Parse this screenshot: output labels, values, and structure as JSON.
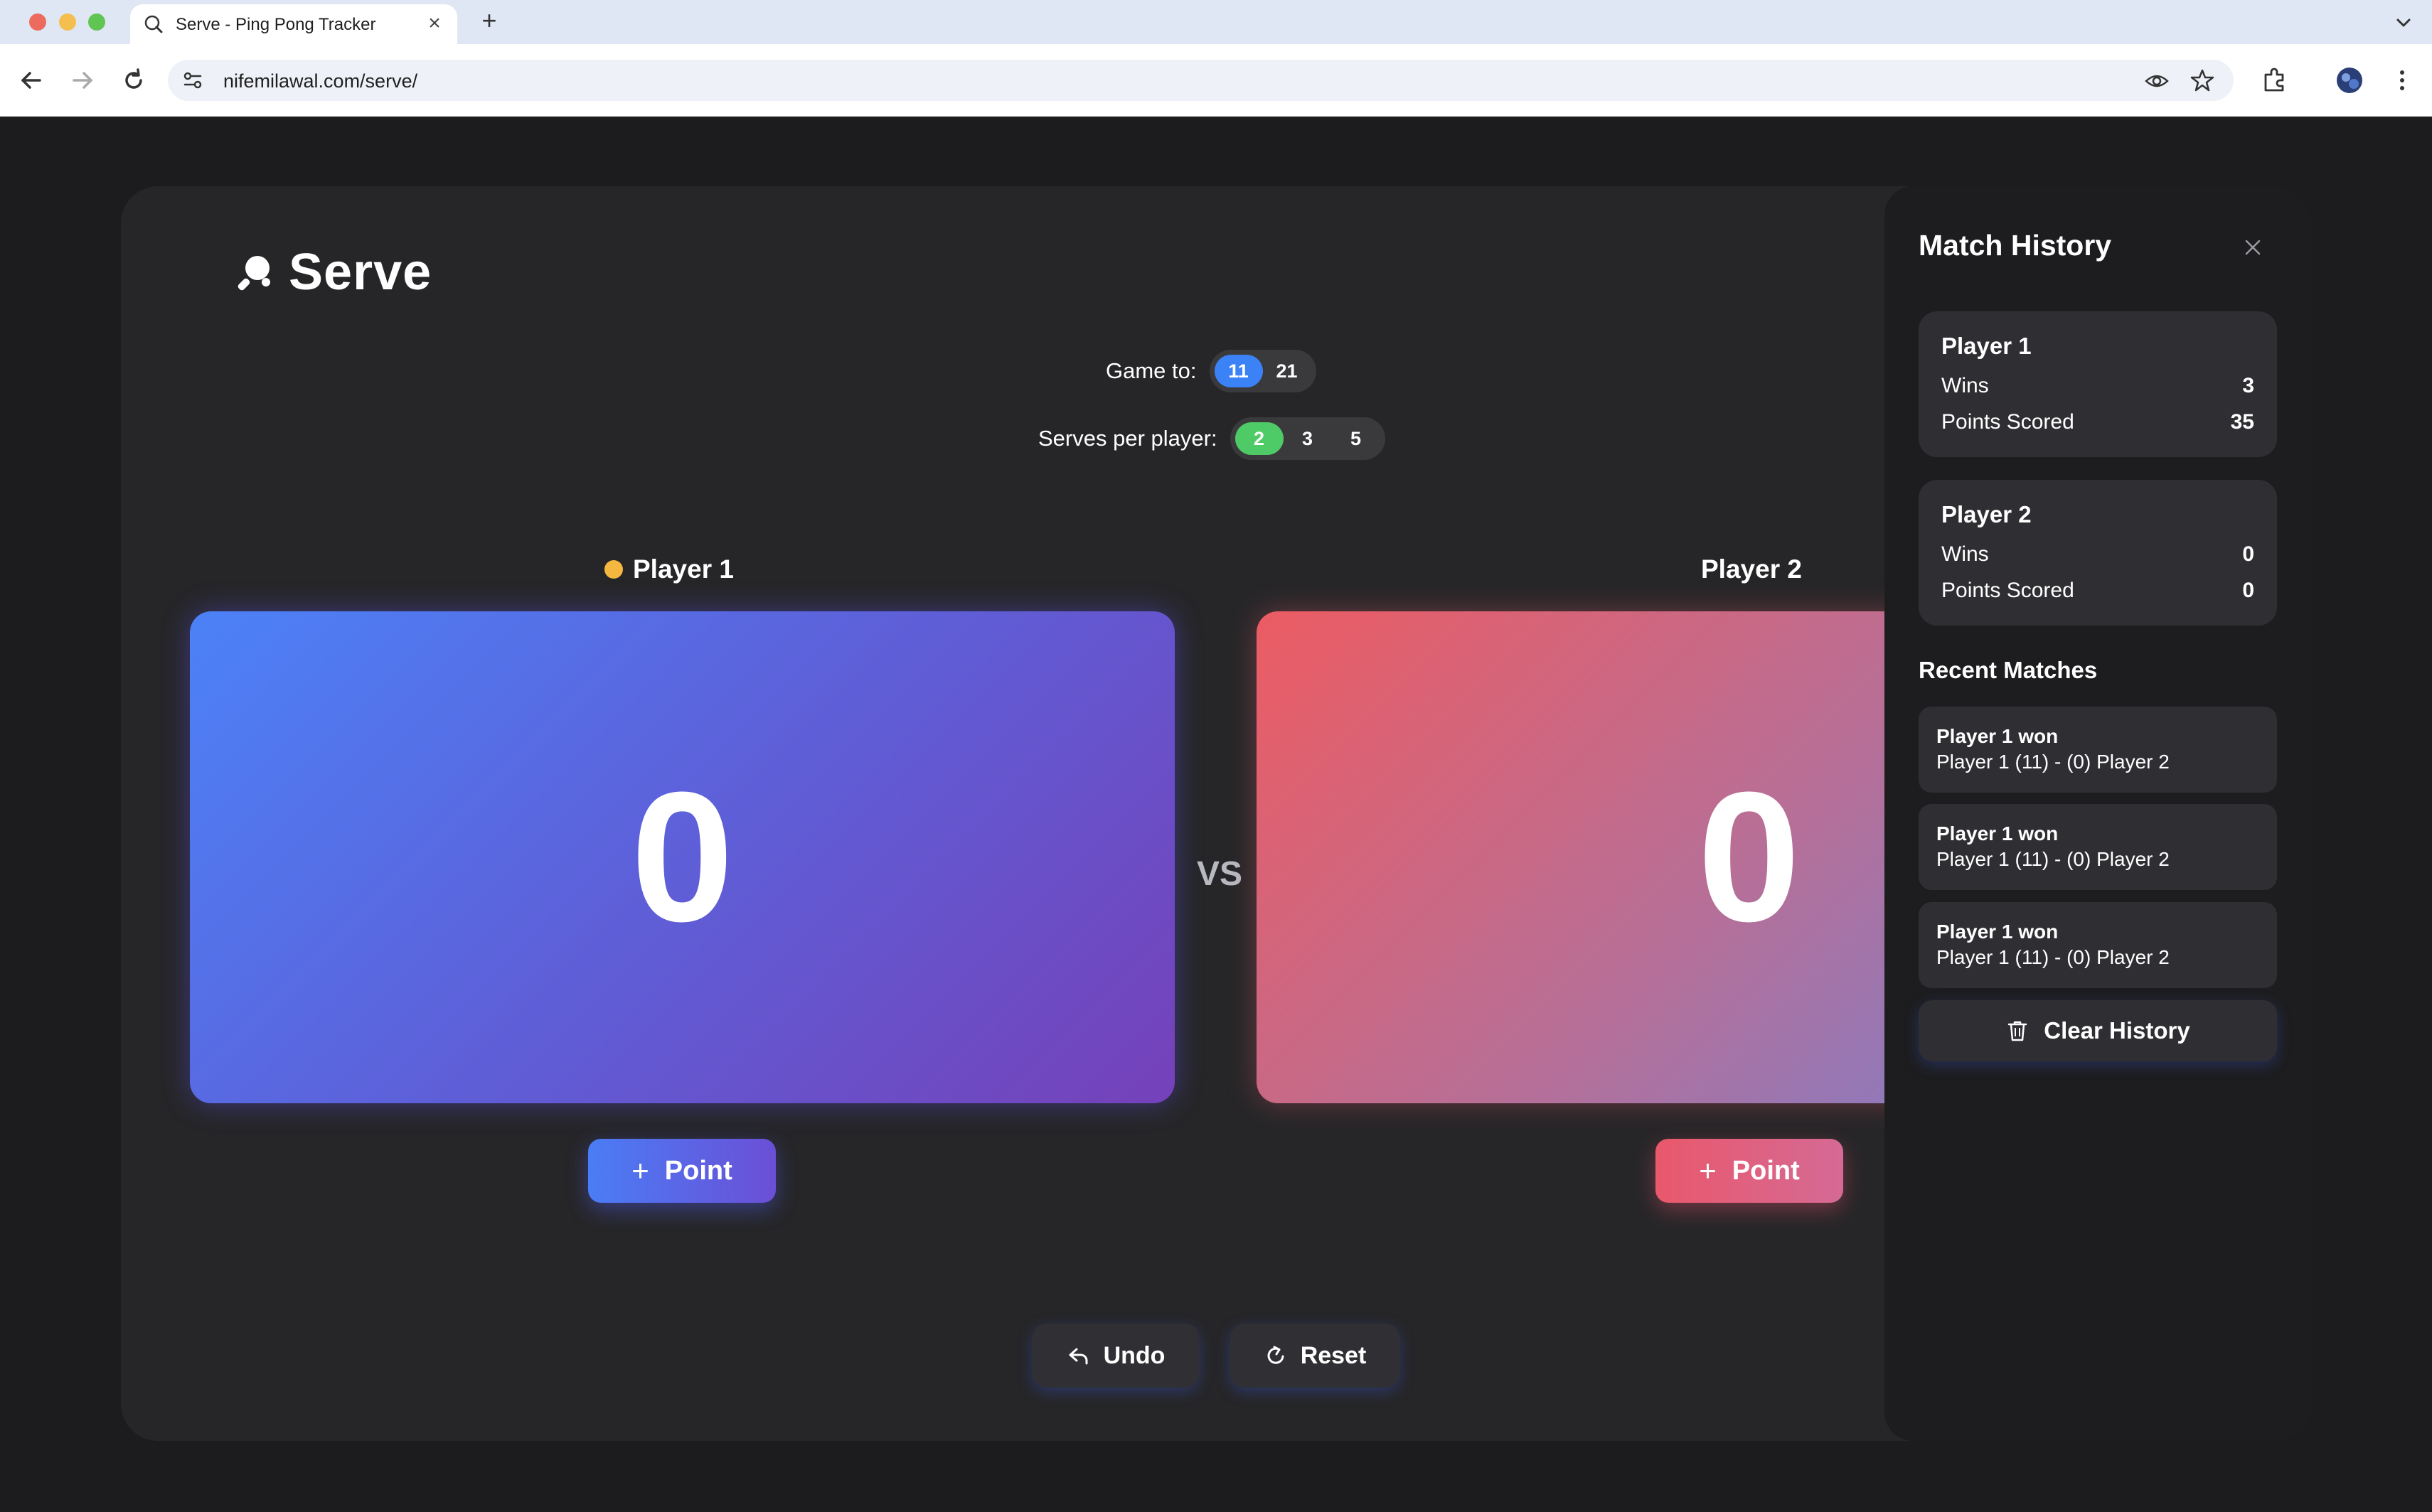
{
  "browser": {
    "tab_title": "Serve - Ping Pong Tracker",
    "new_tab": "+",
    "close_tab": "×",
    "url": "nifemilawal.com/serve/"
  },
  "app": {
    "brand": "Serve",
    "game_to": {
      "label": "Game to:",
      "options": [
        "11",
        "21"
      ],
      "selected": "11"
    },
    "serves_per_player": {
      "label": "Serves per player:",
      "options": [
        "2",
        "3",
        "5"
      ],
      "selected": "2"
    },
    "players": [
      {
        "name": "Player 1",
        "score": "0",
        "serving": true,
        "point_label": "Point",
        "accent": "#4c82f7"
      },
      {
        "name": "Player 2",
        "score": "0",
        "serving": false,
        "point_label": "Point",
        "accent": "#ec5c63"
      }
    ],
    "vs": "VS",
    "undo_label": "Undo",
    "reset_label": "Reset"
  },
  "history": {
    "title": "Match History",
    "stats": [
      {
        "name": "Player 1",
        "wins_label": "Wins",
        "wins": "3",
        "points_label": "Points Scored",
        "points": "35"
      },
      {
        "name": "Player 2",
        "wins_label": "Wins",
        "wins": "0",
        "points_label": "Points Scored",
        "points": "0"
      }
    ],
    "recent_title": "Recent Matches",
    "matches": [
      {
        "winner": "Player 1 won",
        "score": "Player 1 (11) - (0) Player 2"
      },
      {
        "winner": "Player 1 won",
        "score": "Player 1 (11) - (0) Player 2"
      },
      {
        "winner": "Player 1 won",
        "score": "Player 1 (11) - (0) Player 2"
      }
    ],
    "clear_label": "Clear History"
  },
  "colors": {
    "serve_indicator": "#f4b73f",
    "selected_blue": "#3b82f6",
    "selected_green": "#4ecb66"
  }
}
